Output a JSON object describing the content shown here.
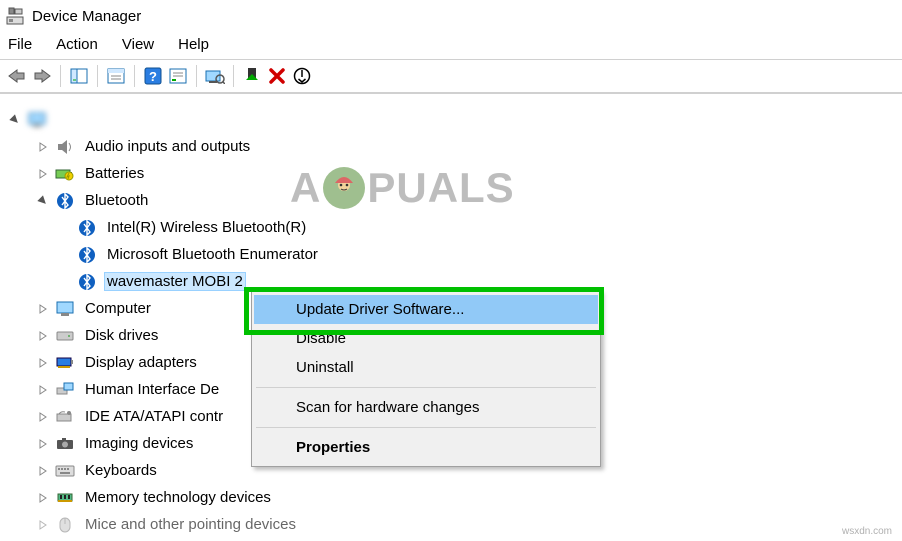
{
  "title": "Device Manager",
  "menu": {
    "file": "File",
    "action": "Action",
    "view": "View",
    "help": "Help"
  },
  "tree": {
    "root": " ",
    "audio": "Audio inputs and outputs",
    "batteries": "Batteries",
    "bluetooth": "Bluetooth",
    "bt_items": {
      "intel": "Intel(R) Wireless Bluetooth(R)",
      "msenum": "Microsoft Bluetooth Enumerator",
      "wavemaster": "wavemaster MOBI 2"
    },
    "computer": "Computer",
    "disk": "Disk drives",
    "display": "Display adapters",
    "hid": "Human Interface De",
    "ide": "IDE ATA/ATAPI contr",
    "imaging": "Imaging devices",
    "keyboards": "Keyboards",
    "memtech": "Memory technology devices",
    "mice": "Mice and other pointing devices"
  },
  "context_menu": {
    "update": "Update Driver Software...",
    "disable": "Disable",
    "uninstall": "Uninstall",
    "scan": "Scan for hardware changes",
    "properties": "Properties"
  },
  "watermark": {
    "pre": "A",
    "post": "PUALS"
  },
  "attribution": "wsxdn.com"
}
